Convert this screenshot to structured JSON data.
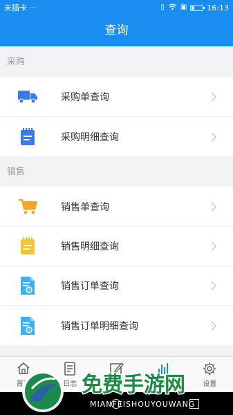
{
  "status": {
    "carrier": "未插卡",
    "dots": "···",
    "time": "16:13",
    "battery_level": 0.25
  },
  "header": {
    "title": "查询"
  },
  "sections": [
    {
      "title": "采购",
      "items": [
        {
          "label": "采购单查询",
          "icon": "truck-icon"
        },
        {
          "label": "采购明细查询",
          "icon": "notepad-icon"
        }
      ]
    },
    {
      "title": "销售",
      "items": [
        {
          "label": "销售单查询",
          "icon": "cart-icon"
        },
        {
          "label": "销售明细查询",
          "icon": "notepad-icon"
        },
        {
          "label": "销售订单查询",
          "icon": "document-icon"
        },
        {
          "label": "销售订单明细查询",
          "icon": "document-icon"
        }
      ]
    }
  ],
  "tabs": [
    {
      "label": "首页",
      "icon": "home-icon"
    },
    {
      "label": "日志",
      "icon": "log-icon"
    },
    {
      "label": "开单",
      "icon": "edit-icon"
    },
    {
      "label": "查询",
      "icon": "chart-icon",
      "active": true
    },
    {
      "label": "设置",
      "icon": "gear-icon"
    }
  ],
  "watermark": {
    "title": "免费手游网",
    "subtitle": "MIANFEISHOUYOUWANG"
  },
  "colors": {
    "accent": "#1a8ef0",
    "icon_blue": "#3a7be8",
    "icon_orange": "#f5a623",
    "icon_cyan": "#3ab1f2",
    "icon_yellow": "#f7c32e"
  }
}
